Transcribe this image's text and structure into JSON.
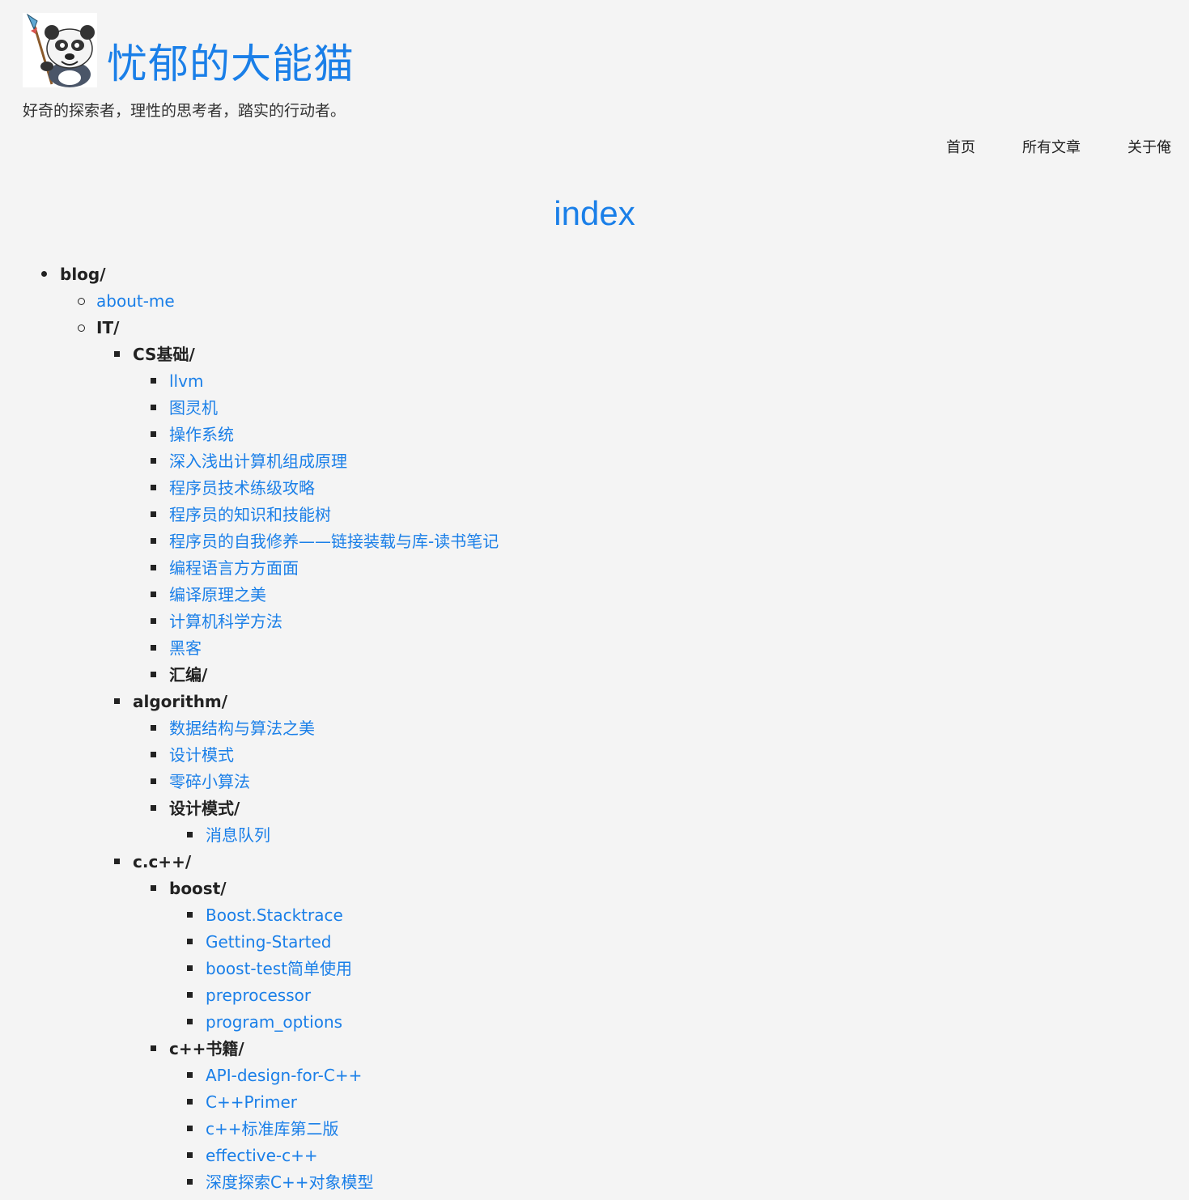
{
  "header": {
    "site_title": "忧郁的大能猫",
    "tagline": "好奇的探索者，理性的思考者，踏实的行动者。"
  },
  "nav": {
    "items": [
      "首页",
      "所有文章",
      "关于俺"
    ]
  },
  "page": {
    "title": "index"
  },
  "tree": [
    {
      "level": 0,
      "label": "blog/",
      "kind": "folder"
    },
    {
      "level": 1,
      "label": "about-me",
      "kind": "link"
    },
    {
      "level": 1,
      "label": "IT/",
      "kind": "folder"
    },
    {
      "level": 2,
      "label": "CS基础/",
      "kind": "folder"
    },
    {
      "level": 3,
      "label": "llvm",
      "kind": "link"
    },
    {
      "level": 3,
      "label": "图灵机",
      "kind": "link"
    },
    {
      "level": 3,
      "label": "操作系统",
      "kind": "link"
    },
    {
      "level": 3,
      "label": "深入浅出计算机组成原理",
      "kind": "link"
    },
    {
      "level": 3,
      "label": "程序员技术练级攻略",
      "kind": "link"
    },
    {
      "level": 3,
      "label": "程序员的知识和技能树",
      "kind": "link"
    },
    {
      "level": 3,
      "label": "程序员的自我修养——链接装载与库-读书笔记",
      "kind": "link"
    },
    {
      "level": 3,
      "label": "编程语言方方面面",
      "kind": "link"
    },
    {
      "level": 3,
      "label": "编译原理之美",
      "kind": "link"
    },
    {
      "level": 3,
      "label": "计算机科学方法",
      "kind": "link"
    },
    {
      "level": 3,
      "label": "黑客",
      "kind": "link"
    },
    {
      "level": 3,
      "label": "汇编/",
      "kind": "folder"
    },
    {
      "level": 2,
      "label": "algorithm/",
      "kind": "folder"
    },
    {
      "level": 3,
      "label": "数据结构与算法之美",
      "kind": "link"
    },
    {
      "level": 3,
      "label": "设计模式",
      "kind": "link"
    },
    {
      "level": 3,
      "label": "零碎小算法",
      "kind": "link"
    },
    {
      "level": 3,
      "label": "设计模式/",
      "kind": "folder"
    },
    {
      "level": 4,
      "label": "消息队列",
      "kind": "link"
    },
    {
      "level": 2,
      "label": "c.c++/",
      "kind": "folder"
    },
    {
      "level": 3,
      "label": "boost/",
      "kind": "folder"
    },
    {
      "level": 4,
      "label": "Boost.Stacktrace",
      "kind": "link"
    },
    {
      "level": 4,
      "label": "Getting-Started",
      "kind": "link"
    },
    {
      "level": 4,
      "label": "boost-test简单使用",
      "kind": "link"
    },
    {
      "level": 4,
      "label": "preprocessor",
      "kind": "link"
    },
    {
      "level": 4,
      "label": "program_options",
      "kind": "link"
    },
    {
      "level": 3,
      "label": "c++书籍/",
      "kind": "folder"
    },
    {
      "level": 4,
      "label": "API-design-for-C++",
      "kind": "link"
    },
    {
      "level": 4,
      "label": "C++Primer",
      "kind": "link"
    },
    {
      "level": 4,
      "label": "c++标准库第二版",
      "kind": "link"
    },
    {
      "level": 4,
      "label": "effective-c++",
      "kind": "link"
    },
    {
      "level": 4,
      "label": "深度探索C++对象模型",
      "kind": "link"
    }
  ],
  "colors": {
    "accent": "#1a7fe8",
    "background": "#f4f4f4",
    "text": "#222222"
  }
}
